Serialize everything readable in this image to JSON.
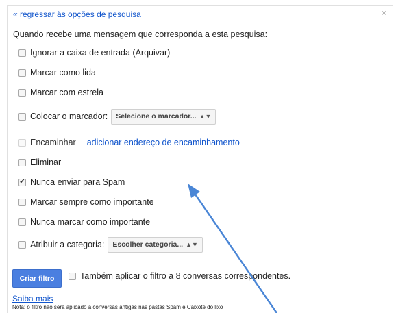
{
  "back_link": "« regressar às opções de pesquisa",
  "close_icon": "close-icon",
  "intro": "Quando recebe uma mensagem que corresponda a esta pesquisa:",
  "options": {
    "archive": {
      "label": "Ignorar a caixa de entrada (Arquivar)",
      "checked": false
    },
    "mark_read": {
      "label": "Marcar como lida",
      "checked": false
    },
    "star": {
      "label": "Marcar com estrela",
      "checked": false
    },
    "apply_label": {
      "label": "Colocar o marcador:",
      "checked": false,
      "select_value": "Selecione o marcador..."
    },
    "forward": {
      "label": "Encaminhar",
      "checked": false,
      "disabled": true,
      "link": "adicionar endereço de encaminhamento"
    },
    "delete": {
      "label": "Eliminar",
      "checked": false
    },
    "never_spam": {
      "label": "Nunca enviar para Spam",
      "checked": true
    },
    "always_important": {
      "label": "Marcar sempre como importante",
      "checked": false
    },
    "never_important": {
      "label": "Nunca marcar como importante",
      "checked": false
    },
    "category": {
      "label": "Atribuir a categoria:",
      "checked": false,
      "select_value": "Escolher categoria..."
    }
  },
  "create_button": "Criar filtro",
  "also_apply": {
    "label": "Também aplicar o filtro a 8 conversas correspondentes.",
    "checked": false
  },
  "learn_more": "Saiba mais",
  "note": "Nota: o filtro não será aplicado a conversas antigas nas pastas Spam e Caixote do lixo",
  "colors": {
    "link": "#1155cc",
    "button": "#4a7fe0",
    "annotation_arrow": "#4a86d6"
  }
}
